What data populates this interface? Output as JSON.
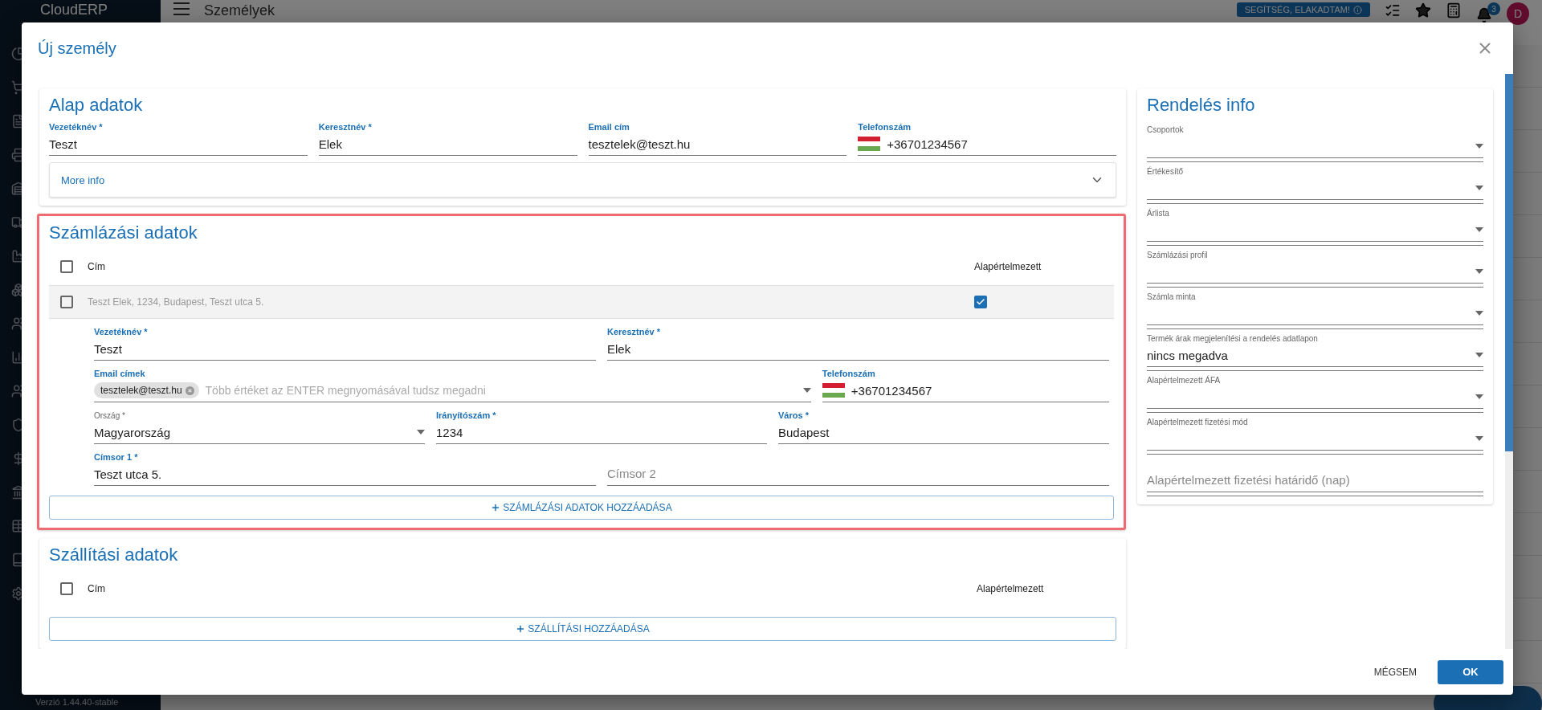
{
  "app": {
    "logo": "CloudERP",
    "page_title": "Személyek",
    "help_button": "SEGÍTSÉG, ELAKADTAM!",
    "notification_count": "3",
    "avatar": "D",
    "version": "Verzió 1.44.40-stable"
  },
  "dialog": {
    "title": "Új személy"
  },
  "basic": {
    "title": "Alap adatok",
    "fields": [
      {
        "kind": "text",
        "label": "Vezetéknév *",
        "value": "Teszt"
      },
      {
        "kind": "text",
        "label": "Keresztnév *",
        "value": "Elek"
      },
      {
        "kind": "text",
        "label": "Email cím",
        "value": "tesztelek@teszt.hu"
      },
      {
        "kind": "phone",
        "label": "Telefonszám",
        "value": "+36701234567"
      }
    ],
    "more_info": {
      "label": "More info",
      "expanded": false
    }
  },
  "billing": {
    "title": "Számlázási adatok",
    "highlighted": true,
    "all_checked": false,
    "columns": [
      "Cím",
      "Alapértelmezett"
    ],
    "rows": [
      {
        "address": "Teszt  Elek, 1234, Budapest, Teszt utca 5.",
        "checked": false,
        "default": true,
        "expanded": true,
        "form": [
          [
            {
              "kind": "text",
              "label": "Vezetéknév *",
              "value": "Teszt"
            },
            {
              "kind": "text",
              "label": "Keresztnév *",
              "value": "Elek"
            }
          ],
          [
            {
              "kind": "chips",
              "label": "Email címek",
              "chips": [
                "tesztelek@teszt.hu"
              ],
              "placeholder": "Több értéket az ENTER megnyomásával tudsz megadni"
            },
            {
              "kind": "phone",
              "label": "Telefonszám",
              "value": "+36701234567"
            }
          ],
          [
            {
              "kind": "select",
              "label": "Ország *",
              "value": "Magyarország"
            },
            {
              "kind": "text",
              "label": "Irányítószám *",
              "value": "1234"
            },
            {
              "kind": "text",
              "label": "Város *",
              "value": "Budapest"
            }
          ],
          [
            {
              "kind": "text",
              "label": "Címsor 1 *",
              "value": "Teszt utca 5."
            },
            {
              "kind": "text",
              "label": "Címsor 2"
            }
          ]
        ]
      }
    ],
    "add_button": "SZÁMLÁZÁSI ADATOK HOZZÁADÁSA"
  },
  "shipping": {
    "title": "Szállítási adatok",
    "all_checked": false,
    "columns": [
      "Cím",
      "Alapértelmezett"
    ],
    "add_button": "SZÁLLÍTÁSI HOZZÁADÁSA"
  },
  "order_info": {
    "title": "Rendelés info",
    "fields": [
      {
        "kind": "select",
        "label": "Csoportok"
      },
      {
        "kind": "select",
        "label": "Értékesítő"
      },
      {
        "kind": "select",
        "label": "Árlista"
      },
      {
        "kind": "select",
        "label": "Számlázási profil"
      },
      {
        "kind": "select",
        "label": "Számla minta"
      },
      {
        "kind": "select",
        "label": "Termék árak megjelenítési a rendelés adatlapon",
        "value": "nincs megadva"
      },
      {
        "kind": "select",
        "label": "Alapértelmezett ÁFA"
      },
      {
        "kind": "select",
        "label": "Alapértelmezett fizetési mód"
      },
      {
        "kind": "text",
        "label": "Alapértelmezett fizetési határidő (nap)"
      }
    ]
  },
  "footer": {
    "cancel": "MÉGSEM",
    "ok": "OK"
  }
}
